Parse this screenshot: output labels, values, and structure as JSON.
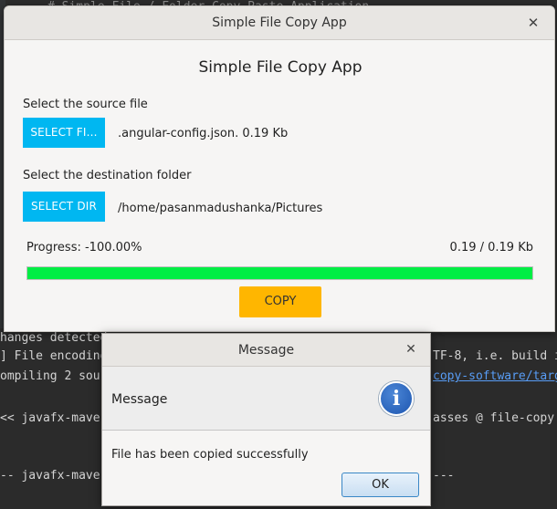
{
  "background_ide": {
    "lines": [
      "# Simple File / Folder Copy-Paste Application",
      "hanges detected",
      "] File encoding",
      "ompiling 2 sou",
      "<< javafx-mave",
      "-- javafx-mave"
    ],
    "right_fragments": [
      "TF-8, i.e. build i",
      "copy-software/targ",
      "asses @ file-copy",
      "---"
    ]
  },
  "app_window": {
    "title": "Simple File Copy App",
    "heading": "Simple File Copy App",
    "source_label": "Select the source file",
    "select_file_button": "SELECT FI...",
    "source_info": ".angular-config.json. 0.19 Kb",
    "destination_label": "Select the destination folder",
    "select_dir_button": "SELECT DIR",
    "destination_info": "/home/pasanmadushanka/Pictures",
    "progress_text": "Progress: -100.00%",
    "size_text": "0.19 / 0.19 Kb",
    "progress_fraction": 1.0,
    "copy_button": "COPY",
    "close_glyph": "✕"
  },
  "dialog": {
    "title": "Message",
    "header_text": "Message",
    "info_glyph": "i",
    "content_text": "File has been copied successfully",
    "ok_button": "OK",
    "close_glyph": "✕"
  },
  "colors": {
    "select_buttons": "#00b7f1",
    "copy_button": "#ffb600",
    "progress_fill": "#00ee44"
  }
}
